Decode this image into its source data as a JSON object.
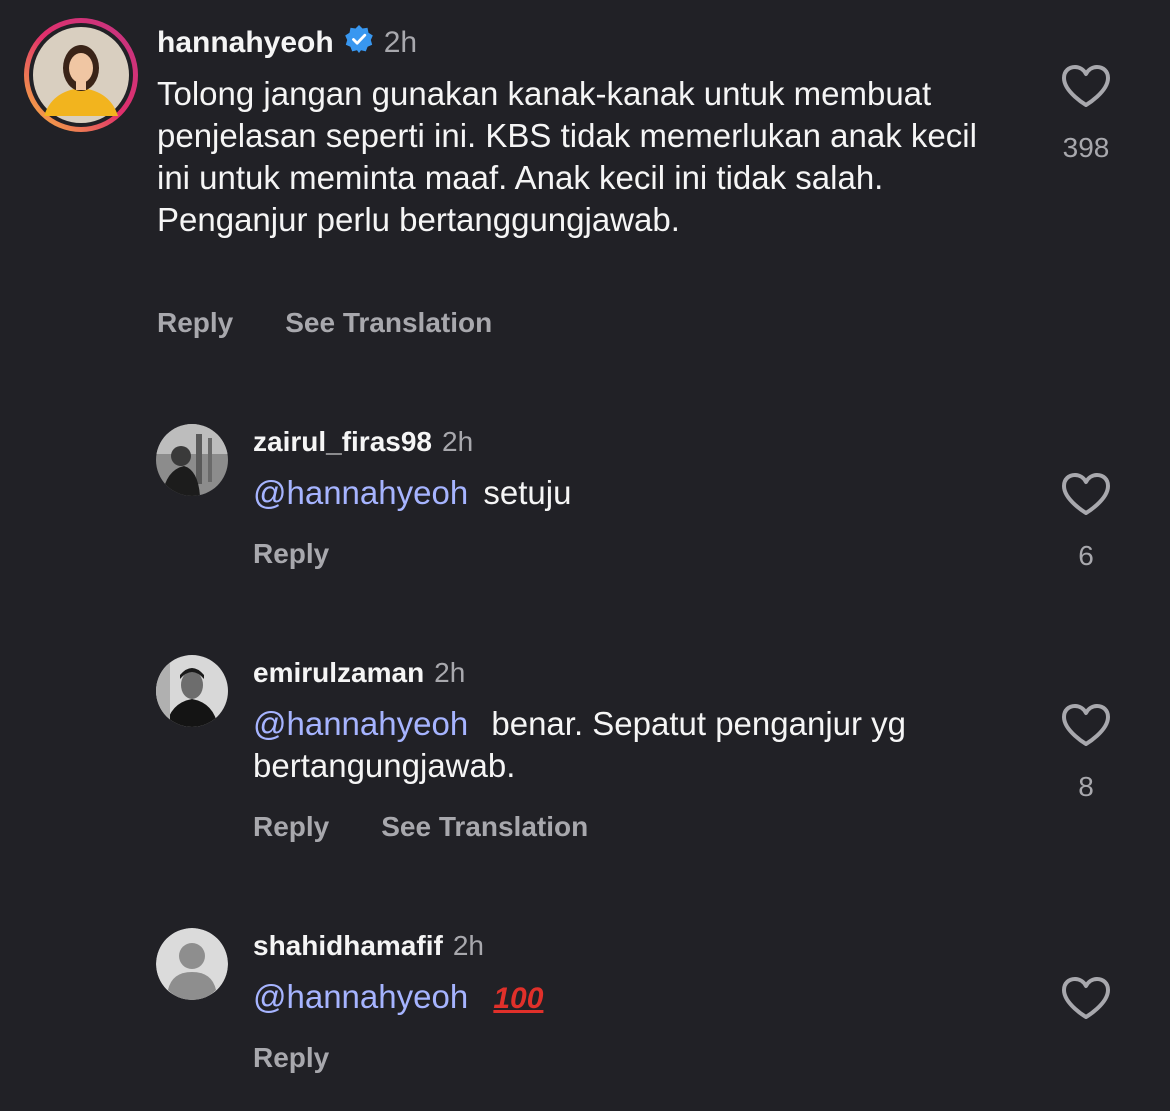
{
  "comments": [
    {
      "username": "hannahyeoh",
      "time": "2h",
      "verified": true,
      "text": "Tolong jangan gunakan kanak-kanak untuk membuat penjelasan seperti ini. KBS tidak memerlukan anak kecil ini untuk meminta maaf. Anak kecil ini tidak salah. Penganjur perlu bertanggungjawab.",
      "reply_label": "Reply",
      "translate_label": "See Translation",
      "likes": "398"
    },
    {
      "username": "zairul_firas98",
      "time": "2h",
      "mention": "@hannahyeoh",
      "text": "setuju",
      "reply_label": "Reply",
      "likes": "6"
    },
    {
      "username": "emirulzaman",
      "time": "2h",
      "mention": "@hannahyeoh",
      "text": "benar. Sepatut penganjur yg bertangungjawab.",
      "reply_label": "Reply",
      "translate_label": "See Translation",
      "likes": "8"
    },
    {
      "username": "shahidhamafif",
      "time": "2h",
      "mention": "@hannahyeoh",
      "emoji": "100",
      "reply_label": "Reply"
    }
  ],
  "icons": {
    "verified": "verified-badge-icon",
    "like": "heart-outline-icon",
    "default_avatar": "default-avatar-icon"
  },
  "colors": {
    "background": "#212126",
    "mention": "#a6b4ff",
    "verified": "#3897f0",
    "muted": "#a8a8ad"
  }
}
